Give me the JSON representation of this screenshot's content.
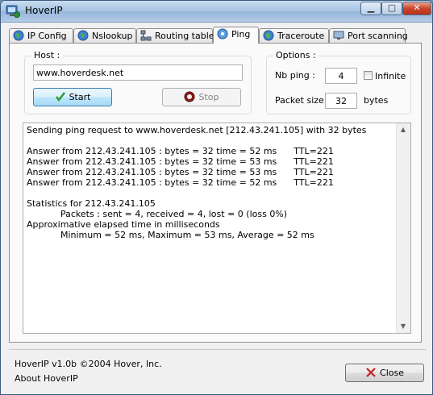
{
  "window": {
    "title": "HoverIP"
  },
  "tabs": [
    {
      "label": "IP Config",
      "icon": "globe-icon"
    },
    {
      "label": "Nslookup",
      "icon": "globe-icon"
    },
    {
      "label": "Routing table",
      "icon": "network-icon"
    },
    {
      "label": "Ping",
      "icon": "ping-icon",
      "active": true
    },
    {
      "label": "Traceroute",
      "icon": "globe-icon"
    },
    {
      "label": "Port scanning",
      "icon": "monitor-icon"
    }
  ],
  "host": {
    "group_label": "Host :",
    "value": "www.hoverdesk.net",
    "start_label": "Start",
    "stop_label": "Stop"
  },
  "options": {
    "group_label": "Options :",
    "nb_ping_label": "Nb ping :",
    "nb_ping_value": "4",
    "infinite_label": "Infinite",
    "infinite_checked": false,
    "packet_size_label": "Packet size :",
    "packet_size_value": "32",
    "packet_size_unit": "bytes"
  },
  "output": {
    "lines": [
      "Sending ping request to www.hoverdesk.net [212.43.241.105] with 32 bytes",
      "",
      "Answer from 212.43.241.105 : bytes = 32 time = 52 ms      TTL=221",
      "Answer from 212.43.241.105 : bytes = 32 time = 53 ms      TTL=221",
      "Answer from 212.43.241.105 : bytes = 32 time = 53 ms      TTL=221",
      "Answer from 212.43.241.105 : bytes = 32 time = 52 ms      TTL=221",
      "",
      "Statistics for 212.43.241.105",
      "            Packets : sent = 4, received = 4, lost = 0 (loss 0%)",
      "Approximative elapsed time in milliseconds",
      "            Minimum = 52 ms, Maximum = 53 ms, Average = 52 ms"
    ]
  },
  "footer": {
    "version": "HoverIP v1.0b ©2004 Hover, Inc.",
    "about": "About HoverIP",
    "close_label": "Close"
  }
}
